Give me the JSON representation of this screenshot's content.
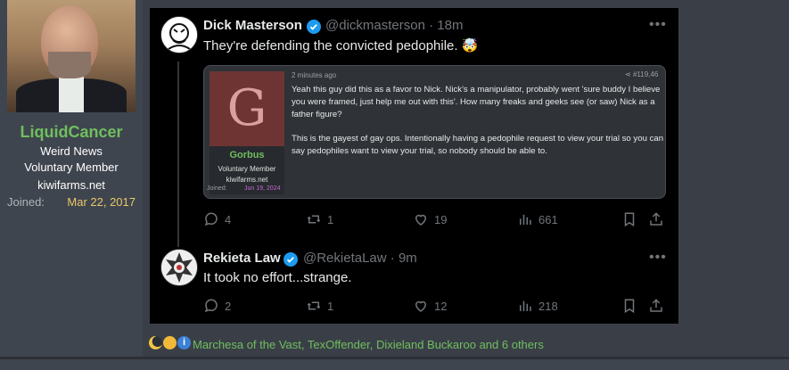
{
  "profile": {
    "username": "LiquidCancer",
    "title": "Weird News",
    "role": "Voluntary Member",
    "site": "kiwifarms.net",
    "joined_label": "Joined:",
    "joined_value": "Mar 22, 2017"
  },
  "tweets": [
    {
      "name": "Dick Masterson",
      "handle": "@dickmasterson",
      "time": "· 18m",
      "text": "They're defending the convicted pedophile. 🤯",
      "quote": {
        "timestamp": "2 minutes ago",
        "post_number": "#119,46",
        "poster": {
          "name": "Gorbus",
          "letter": "G",
          "role": "Voluntary Member",
          "site": "kiwifarms.net",
          "joined_label": "Joined:",
          "joined_value": "Jun 19, 2024"
        },
        "paragraph1": "Yeah this guy did this as a favor to Nick. Nick's a manipulator, probably went 'sure buddy I believe you were framed, just help me out with this'. How many freaks and geeks see (or saw) Nick as a father figure?",
        "paragraph2": "This is the gayest of gay ops. Intentionally having a pedophile request to view your trial so you can say pedophiles want to view your trial, so nobody should be able to."
      },
      "stats": {
        "replies": "4",
        "retweets": "1",
        "likes": "19",
        "views": "661"
      }
    },
    {
      "name": "Rekieta Law",
      "handle": "@RekietaLaw",
      "time": "· 9m",
      "text": "It took no effort...strange.",
      "stats": {
        "replies": "2",
        "retweets": "1",
        "likes": "12",
        "views": "218"
      }
    }
  ],
  "reactions": {
    "icons": [
      "crescent-moon",
      "thinking-face",
      "informative"
    ],
    "text": "Marchesa of the Vast, TexOffender, Dixieland Buckaroo and 6 others"
  },
  "colors": {
    "username_green": "#6fbf5e",
    "joined_date_yellow": "#e8c86a",
    "verified_blue": "#1d9bf0",
    "tweet_bg": "#000000"
  }
}
